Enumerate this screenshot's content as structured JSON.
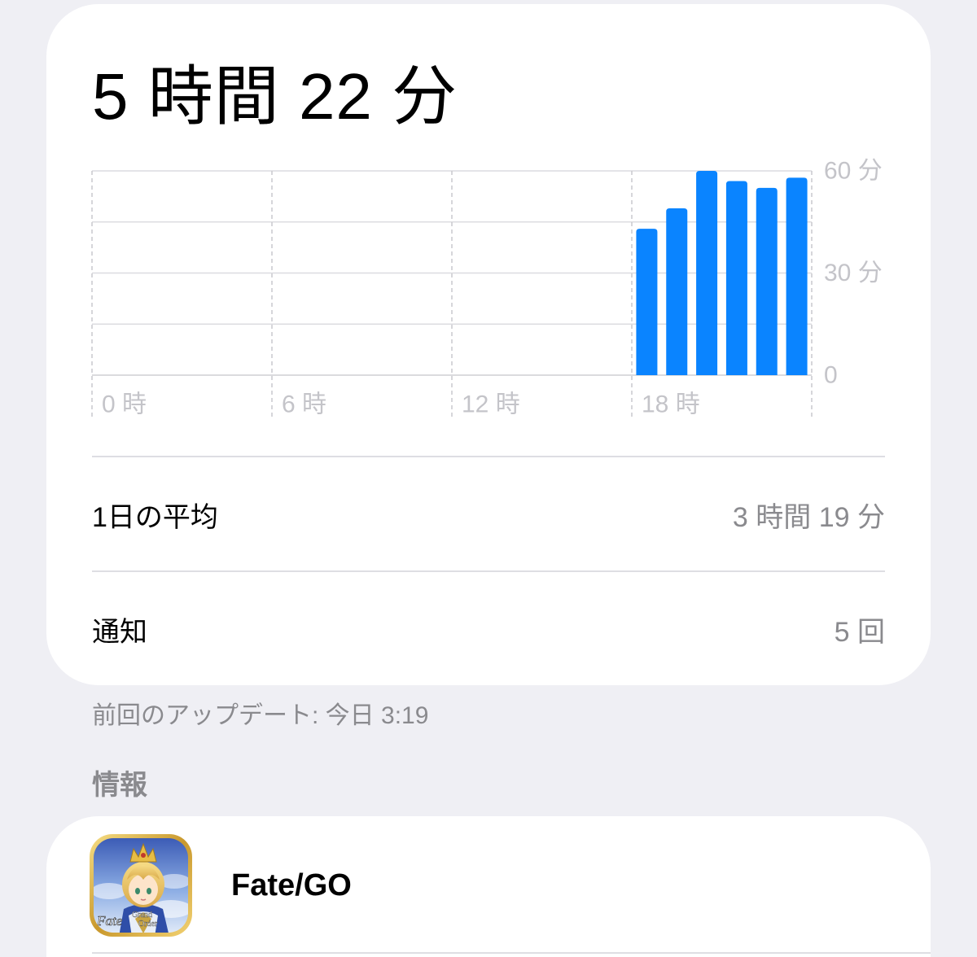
{
  "summary": {
    "total_time": "5 時間 22 分"
  },
  "chart_data": {
    "type": "bar",
    "x": [
      0,
      1,
      2,
      3,
      4,
      5,
      6,
      7,
      8,
      9,
      10,
      11,
      12,
      13,
      14,
      15,
      16,
      17,
      18,
      19,
      20,
      21,
      22,
      23
    ],
    "values": [
      0,
      0,
      0,
      0,
      0,
      0,
      0,
      0,
      0,
      0,
      0,
      0,
      0,
      0,
      0,
      0,
      0,
      0,
      43,
      49,
      60,
      57,
      55,
      58
    ],
    "xlim": [
      0,
      24
    ],
    "ylim": [
      0,
      60
    ],
    "x_ticks": [
      0,
      6,
      12,
      18
    ],
    "x_tick_labels": [
      "0 時",
      "6 時",
      "12 時",
      "18 時"
    ],
    "y_ticks": [
      60,
      30,
      0
    ],
    "y_tick_labels": [
      "60 分",
      "30 分",
      "0"
    ],
    "grid": true,
    "color": "#0a84ff"
  },
  "stats": [
    {
      "label": "1日の平均",
      "value": "3 時間 19 分"
    },
    {
      "label": "通知",
      "value": "5 回"
    }
  ],
  "last_update": "前回のアップデート: 今日 3:19",
  "section_header": "情報",
  "app": {
    "name": "Fate/GO",
    "icon": "fate-go-app-icon",
    "icon_lettering": [
      "Fate",
      "Grand",
      "Order"
    ]
  }
}
